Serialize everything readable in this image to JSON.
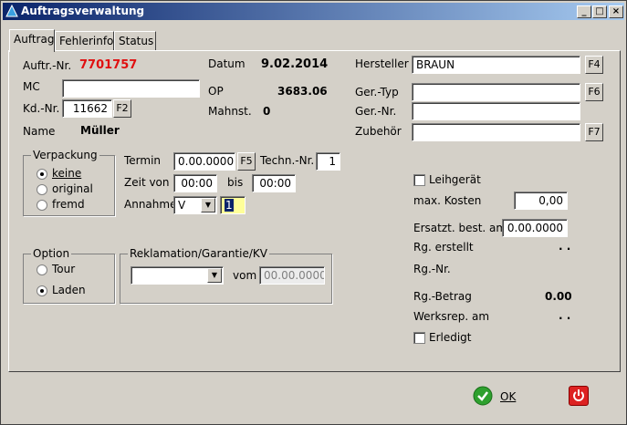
{
  "window": {
    "title": "Auftragsverwaltung",
    "min": "_",
    "max": "□",
    "close": "×"
  },
  "tabs": [
    {
      "label": "Auftrag"
    },
    {
      "label": "Fehlerinfo"
    },
    {
      "label": "Status"
    }
  ],
  "left": {
    "auftr_label": "Auftr.-Nr.",
    "auftr_value": "7701757",
    "mc_label": "MC",
    "mc_value": "",
    "kd_label": "Kd.-Nr.",
    "kd_value": "11662",
    "kd_btn": "F2",
    "name_label": "Name",
    "name_value": "Müller"
  },
  "mid": {
    "datum_label": "Datum",
    "datum_value": "9.02.2014",
    "op_label": "OP",
    "op_value": "3683.06",
    "mahn_label": "Mahnst.",
    "mahn_value": "0"
  },
  "right": {
    "hersteller_label": "Hersteller",
    "hersteller_value": "BRAUN",
    "hersteller_btn": "F4",
    "gertyp_label": "Ger.-Typ",
    "gertyp_value": "",
    "gertyp_btn": "F6",
    "gernr_label": "Ger.-Nr.",
    "gernr_value": "",
    "zubehoer_label": "Zubehör",
    "zubehoer_value": "",
    "zubehoer_btn": "F7"
  },
  "verpackung": {
    "title": "Verpackung",
    "options": [
      "keine",
      "original",
      "fremd"
    ]
  },
  "termin": {
    "termin_label": "Termin",
    "termin_value": "0.00.0000",
    "termin_btn": "F5",
    "techn_label": "Techn.-Nr.",
    "techn_value": "1",
    "zeit_label": "Zeit von",
    "zeit_von": "00:00",
    "bis_label": "bis",
    "zeit_bis": "00:00",
    "annahme_label": "Annahme",
    "annahme_value": "V",
    "annahme_extra": "1"
  },
  "option": {
    "title": "Option",
    "options": [
      "Tour",
      "Laden"
    ]
  },
  "reklamation": {
    "title": "Reklamation/Garantie/KV",
    "select_value": "",
    "vom_label": "vom",
    "vom_value": "00.00.0000"
  },
  "status": {
    "leih_label": "Leihgerät",
    "maxk_label": "max. Kosten",
    "maxk_value": "0,00",
    "ersatz_label": "Ersatzt. best. am",
    "ersatz_value": "0.00.0000",
    "rgerst_label": "Rg. erstellt",
    "rgerst_value": ". .",
    "rgnr_label": "Rg.-Nr.",
    "rgbetrag_label": "Rg.-Betrag",
    "rgbetrag_value": "0.00",
    "werks_label": "Werksrep. am",
    "werks_value": ". .",
    "erledigt_label": "Erledigt"
  },
  "footer": {
    "ok_label": "OK"
  }
}
